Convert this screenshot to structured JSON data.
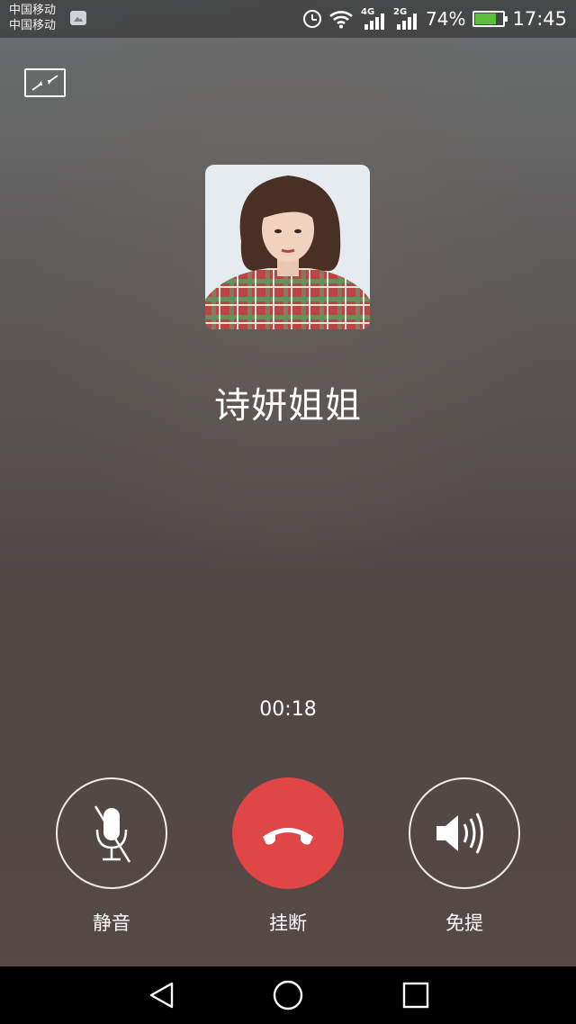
{
  "status_bar": {
    "carrier_1": "中国移动",
    "carrier_2": "中国移动",
    "net_1": "4G",
    "net_2": "2G",
    "battery_percent": "74%",
    "battery_level": 0.74,
    "time": "17:45",
    "icons": [
      "gallery-icon",
      "alarm-icon",
      "wifi-icon",
      "signal-icon",
      "signal-icon",
      "battery-charging-icon"
    ]
  },
  "call": {
    "caller_name": "诗妍姐姐",
    "duration": "00:18"
  },
  "controls": {
    "mute_label": "静音",
    "hangup_label": "挂断",
    "speaker_label": "免提"
  },
  "colors": {
    "hangup": "#e04646",
    "battery_fill": "#58c23a",
    "navbar": "#000000"
  },
  "nav": {
    "icons": [
      "back-icon",
      "home-icon",
      "recents-icon"
    ]
  }
}
